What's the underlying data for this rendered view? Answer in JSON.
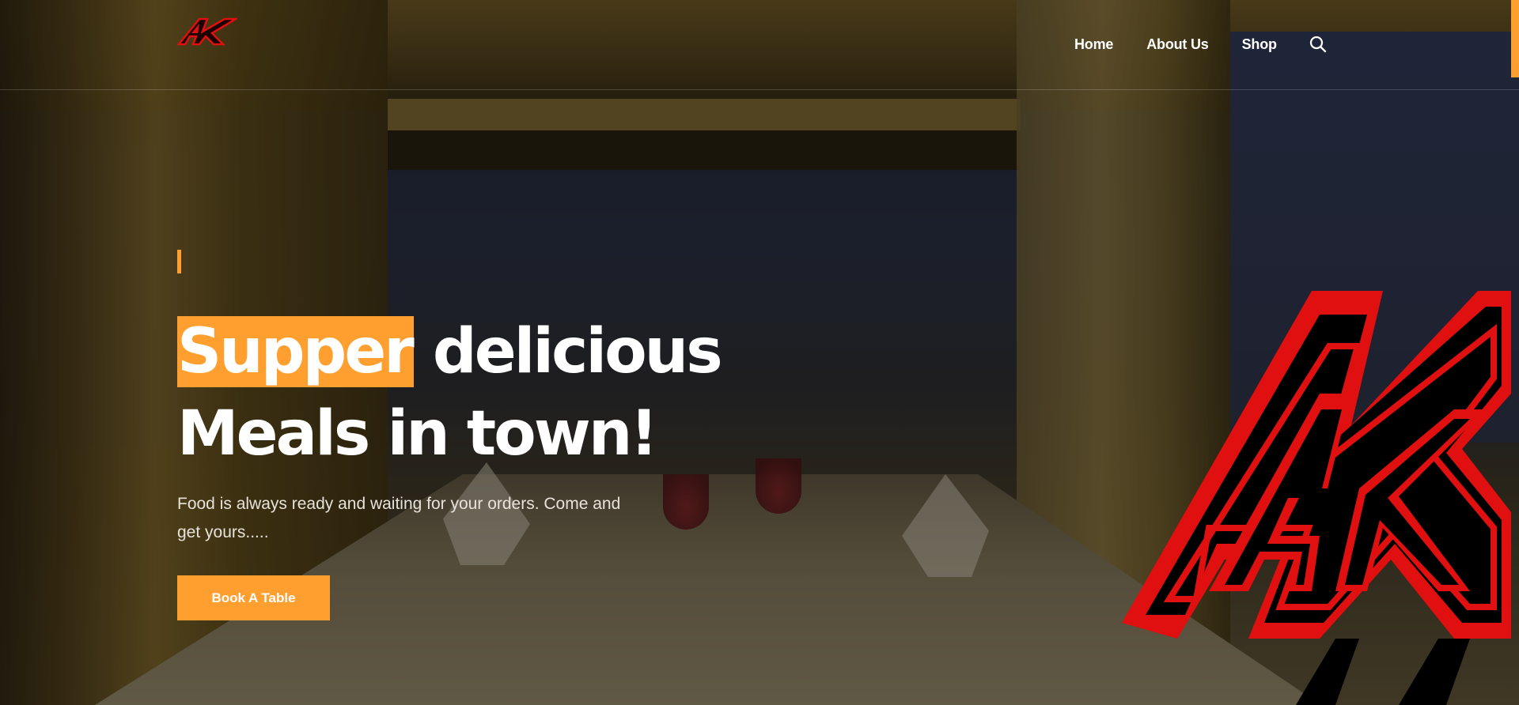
{
  "brand": {
    "logo_text": "AK",
    "logo_colors": {
      "primary": "#e01010",
      "outline": "#000000"
    }
  },
  "nav": {
    "items": [
      {
        "label": "Home"
      },
      {
        "label": "About Us"
      },
      {
        "label": "Shop"
      }
    ],
    "search_icon": "search-icon"
  },
  "hero": {
    "title_highlight": "Supper",
    "title_rest_line1": " delicious",
    "title_line2": "Meals in town!",
    "description": "Food is always ready and waiting for your orders. Come and get yours.....",
    "cta_label": "Book A Table"
  },
  "colors": {
    "accent": "#ff9f2f",
    "text": "#ffffff"
  }
}
